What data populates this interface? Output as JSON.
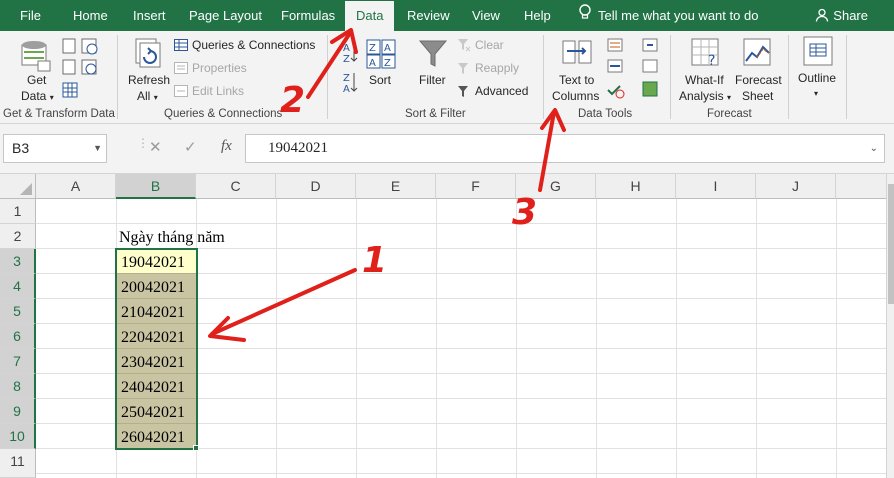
{
  "ribbon_tabs": [
    {
      "label": "File"
    },
    {
      "label": "Home"
    },
    {
      "label": "Insert"
    },
    {
      "label": "Page Layout"
    },
    {
      "label": "Formulas"
    },
    {
      "label": "Data",
      "active": true
    },
    {
      "label": "Review"
    },
    {
      "label": "View"
    },
    {
      "label": "Help"
    }
  ],
  "tell_me": "Tell me what you want to do",
  "share_label": "Share",
  "groups": {
    "get_transform": {
      "label": "Get & Transform Data",
      "get_data": "Get",
      "get_data_2": "Data"
    },
    "queries": {
      "label": "Queries & Connections",
      "refresh": "Refresh",
      "refresh_2": "All",
      "queries_connections": "Queries & Connections",
      "properties": "Properties",
      "edit_links": "Edit Links"
    },
    "sort_filter": {
      "label": "Sort & Filter",
      "sort": "Sort",
      "filter": "Filter",
      "clear": "Clear",
      "reapply": "Reapply",
      "advanced": "Advanced"
    },
    "data_tools": {
      "label": "Data Tools",
      "text_to_columns": "Text to",
      "text_to_columns_2": "Columns"
    },
    "forecast": {
      "label": "Forecast",
      "what_if": "What-If",
      "what_if_2": "Analysis",
      "forecast_sheet": "Forecast",
      "forecast_sheet_2": "Sheet"
    },
    "outline": {
      "label": "Outline"
    }
  },
  "name_box": "B3",
  "formula_value": "19042021",
  "columns": [
    "A",
    "B",
    "C",
    "D",
    "E",
    "F",
    "G",
    "H",
    "I",
    "J"
  ],
  "selected_column": "B",
  "rows": [
    "1",
    "2",
    "3",
    "4",
    "5",
    "6",
    "7",
    "8",
    "9",
    "10",
    "11"
  ],
  "header_cell": "Ngày tháng năm",
  "cells_b": [
    "19042021",
    "20042021",
    "21042021",
    "22042021",
    "23042021",
    "24042021",
    "25042021",
    "26042021"
  ],
  "annotations": [
    "1",
    "2",
    "3"
  ],
  "colors": {
    "excel_green": "#217346",
    "arrow_red": "#e0201a",
    "selection_fill": "#c9c5a3",
    "active_cell_fill": "#ffffcc"
  }
}
